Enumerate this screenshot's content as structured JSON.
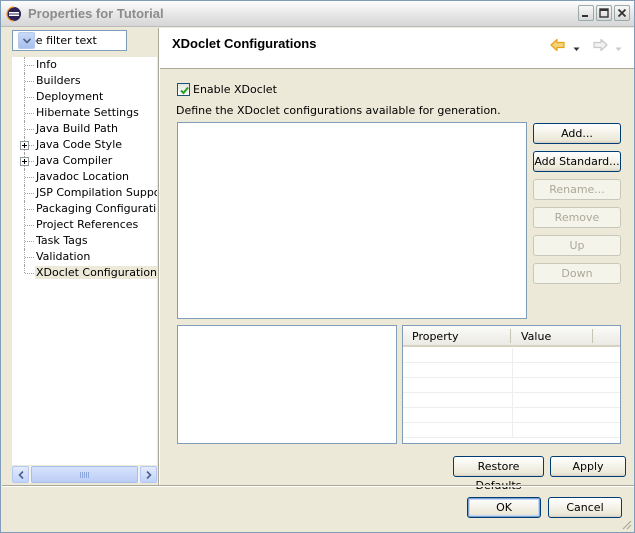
{
  "window": {
    "title": "Properties for Tutorial",
    "icons": {
      "app": "eclipse-icon",
      "minimize": "minimize-icon",
      "maximize": "maximize-icon",
      "close": "close-icon"
    }
  },
  "filter": {
    "value": "type filter text"
  },
  "tree": {
    "items": [
      {
        "label": "Info",
        "expandable": false
      },
      {
        "label": "Builders",
        "expandable": false
      },
      {
        "label": "Deployment",
        "expandable": false
      },
      {
        "label": "Hibernate Settings",
        "expandable": false
      },
      {
        "label": "Java Build Path",
        "expandable": false
      },
      {
        "label": "Java Code Style",
        "expandable": true
      },
      {
        "label": "Java Compiler",
        "expandable": true
      },
      {
        "label": "Javadoc Location",
        "expandable": false
      },
      {
        "label": "JSP Compilation Support",
        "expandable": false
      },
      {
        "label": "Packaging Configurations",
        "expandable": false
      },
      {
        "label": "Project References",
        "expandable": false
      },
      {
        "label": "Task Tags",
        "expandable": false
      },
      {
        "label": "Validation",
        "expandable": false
      },
      {
        "label": "XDoclet Configurations",
        "expandable": false,
        "selected": true
      }
    ]
  },
  "page": {
    "title": "XDoclet Configurations",
    "enable_label": "Enable XDoclet",
    "enable_checked": true,
    "description": "Define the XDoclet configurations available for generation."
  },
  "side_buttons": [
    {
      "label": "Add...",
      "enabled": true
    },
    {
      "label": "Add Standard...",
      "enabled": true
    },
    {
      "label": "Rename...",
      "enabled": false
    },
    {
      "label": "Remove",
      "enabled": false
    },
    {
      "label": "Up",
      "enabled": false
    },
    {
      "label": "Down",
      "enabled": false
    }
  ],
  "property_table": {
    "columns": [
      "Property",
      "Value"
    ],
    "rows": []
  },
  "footer": {
    "restore_defaults": "Restore Defaults",
    "apply": "Apply",
    "ok": "OK",
    "cancel": "Cancel"
  },
  "colors": {
    "back_arrow": "#e8a317",
    "forward_arrow": "#c8c8c8",
    "selection": "#ece9d8"
  }
}
